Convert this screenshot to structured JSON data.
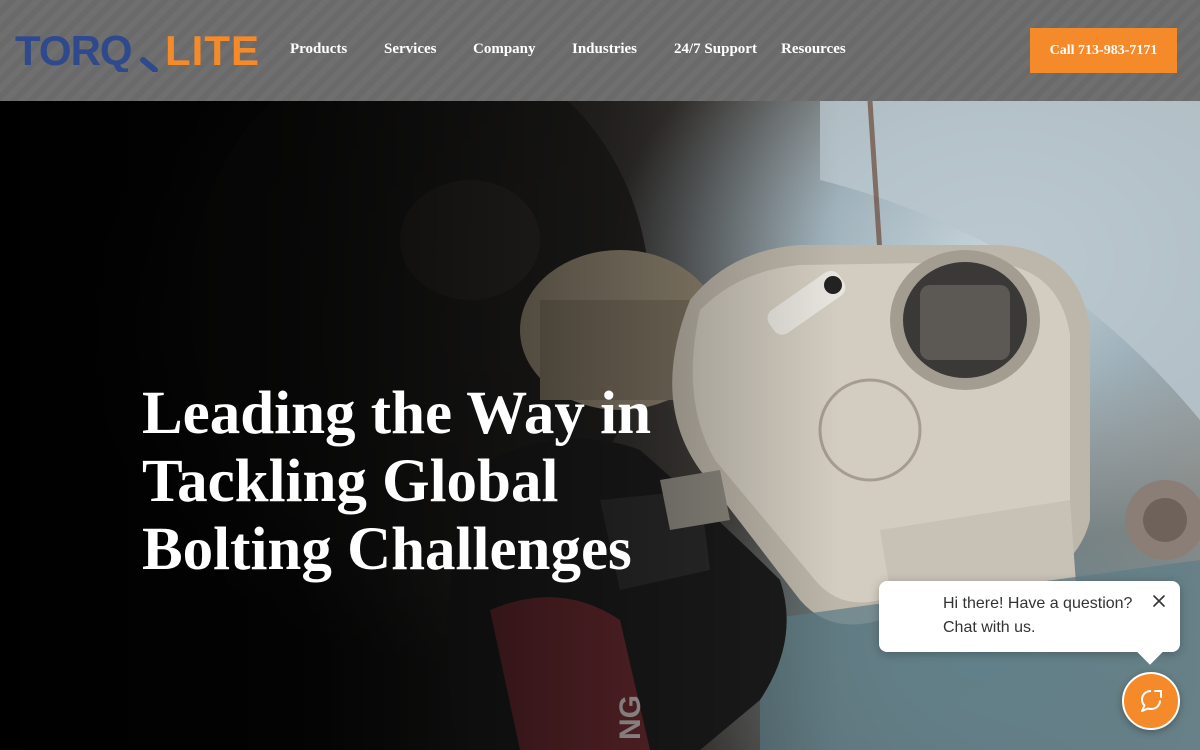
{
  "brand": {
    "name_part1": "TORQ",
    "name_part2": "LITE",
    "primary_color": "#2e4a8c",
    "accent_color": "#f58a2b"
  },
  "nav": {
    "items": [
      {
        "label": "Products"
      },
      {
        "label": "Services"
      },
      {
        "label": "Company"
      },
      {
        "label": "Industries"
      },
      {
        "label": "24/7 Support"
      },
      {
        "label": "Resources"
      }
    ],
    "cta_label": "Call 713-983-7171"
  },
  "hero": {
    "headline_lines": [
      "Leading the Way in",
      "Tackling Global",
      "Bolting Challenges"
    ]
  },
  "chat": {
    "message_line1": "Hi there! Have a question?",
    "message_line2": "Chat with us.",
    "close_icon": "close-icon",
    "launcher_icon": "chat-icon"
  }
}
